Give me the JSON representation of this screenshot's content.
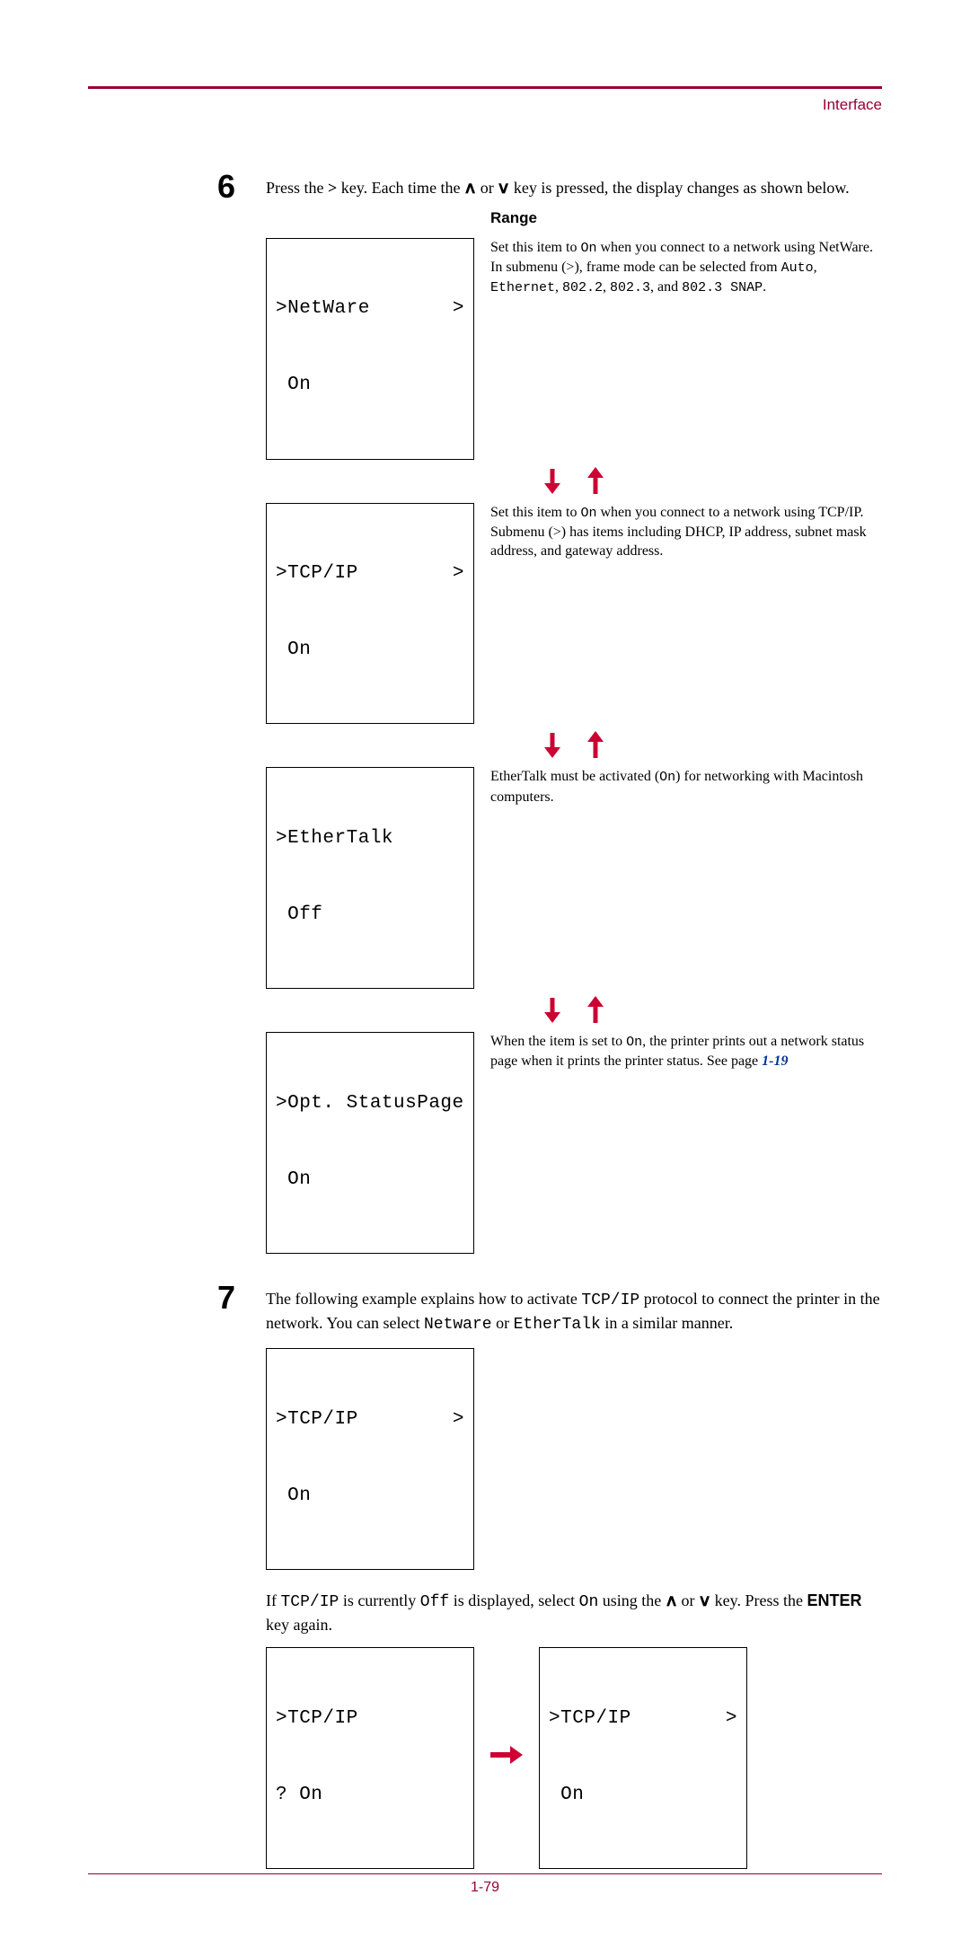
{
  "header": {
    "section": "Interface"
  },
  "step6": {
    "number": "6",
    "intro_pre": "Press the ",
    "intro_key": ">",
    "intro_mid": " key. Each time the ",
    "intro_or": " or ",
    "intro_post": " key is pressed, the display changes as shown below.",
    "range_label": "Range",
    "items": [
      {
        "lcd_line1_left": ">NetWare",
        "lcd_line1_right": ">",
        "lcd_line2": " On",
        "desc_pre": "Set this item to ",
        "desc_on": "On",
        "desc_mid": " when you connect to a network using NetWare. In submenu (>), frame mode can be selected from ",
        "opt1": "Auto",
        "sep1": ", ",
        "opt2": "Ethernet",
        "sep2": ", ",
        "opt3": "802.2",
        "sep3": ", ",
        "opt4": "802.3",
        "sep4": ", and ",
        "opt5": "802.3 SNAP",
        "tail": "."
      },
      {
        "lcd_line1_left": ">TCP/IP",
        "lcd_line1_right": ">",
        "lcd_line2": " On",
        "desc_pre": "Set this item to ",
        "desc_on": "On",
        "desc_mid": " when you connect to a network using TCP/IP. Submenu (>) has items including DHCP, IP address, subnet mask address, and gateway address.",
        "opt1": "",
        "sep1": "",
        "opt2": "",
        "sep2": "",
        "opt3": "",
        "sep3": "",
        "opt4": "",
        "sep4": "",
        "opt5": "",
        "tail": ""
      },
      {
        "lcd_line1_left": ">EtherTalk",
        "lcd_line1_right": "",
        "lcd_line2": " Off",
        "desc_pre": "EtherTalk must be activated (",
        "desc_on": "On",
        "desc_mid": ") for networking with Macintosh computers.",
        "opt1": "",
        "sep1": "",
        "opt2": "",
        "sep2": "",
        "opt3": "",
        "sep3": "",
        "opt4": "",
        "sep4": "",
        "opt5": "",
        "tail": ""
      },
      {
        "lcd_line1_left": ">Opt. StatusPage",
        "lcd_line1_right": "",
        "lcd_line2": " On",
        "desc_pre": "When the item is set to ",
        "desc_on": "On",
        "desc_mid": ", the printer prints out a network status page when it prints the printer status. See page ",
        "page_ref": "1-19",
        "opt1": "",
        "sep1": "",
        "opt2": "",
        "sep2": "",
        "opt3": "",
        "sep3": "",
        "opt4": "",
        "sep4": "",
        "opt5": "",
        "tail": ""
      }
    ]
  },
  "step7": {
    "number": "7",
    "p1_pre": "The following example explains how to activate ",
    "p1_code1": "TCP/IP",
    "p1_mid1": " protocol to connect the printer in the network. You can select ",
    "p1_code2": "Netware",
    "p1_mid2": " or ",
    "p1_code3": "EtherTalk",
    "p1_post": " in a similar manner.",
    "lcd1_line1_left": ">TCP/IP",
    "lcd1_line1_right": ">",
    "lcd1_line2": " On",
    "p2_pre": "If ",
    "p2_code1": "TCP/IP",
    "p2_mid1": " is currently ",
    "p2_code2": "Off",
    "p2_mid2": " is displayed, select ",
    "p2_code3": "On",
    "p2_mid3": " using the ",
    "p2_or": " or ",
    "p2_mid4": " key. Press the ",
    "p2_enter": "ENTER",
    "p2_post": " key again.",
    "lcd2_line1_left": ">TCP/IP",
    "lcd2_line1_right": "",
    "lcd2_line2": "? On",
    "lcd3_line1_left": ">TCP/IP",
    "lcd3_line1_right": ">",
    "lcd3_line2": " On"
  },
  "footer": {
    "page": "1-79"
  }
}
